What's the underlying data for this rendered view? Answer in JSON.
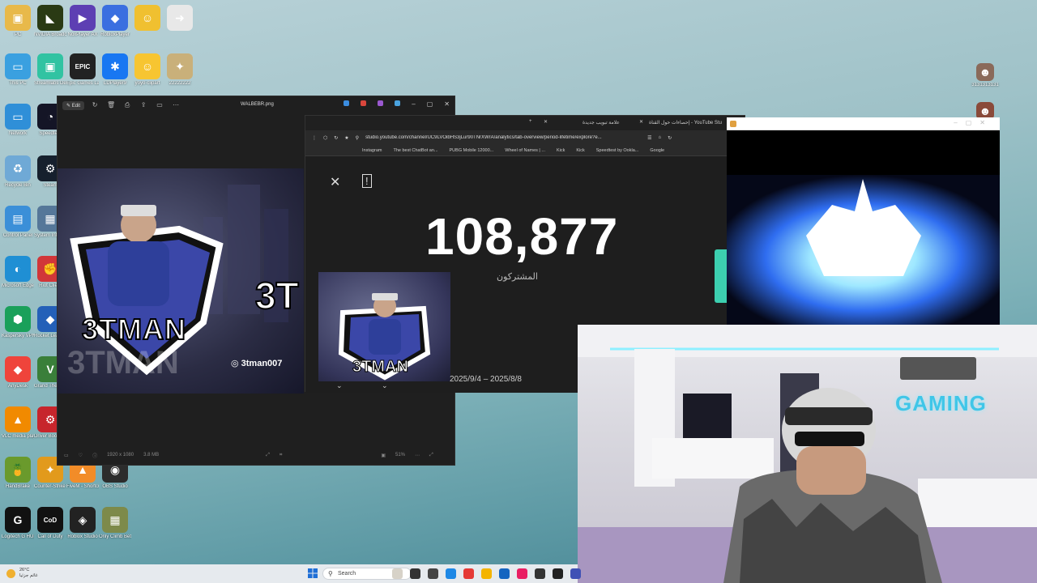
{
  "desktop": {
    "icons": [
      {
        "label": "PC",
        "color": "#e8b94a",
        "glyph": "▣"
      },
      {
        "label": "NVIDIA Broadcast",
        "color": "#2a3a14",
        "glyph": "◣"
      },
      {
        "label": "NoxPlayer AX",
        "color": "#5d3fb3",
        "glyph": "▶"
      },
      {
        "label": "RobloxPlayer",
        "color": "#3a6fe0",
        "glyph": "◆"
      },
      {
        "label": "",
        "color": "#f0c030",
        "glyph": "☺"
      },
      {
        "label": "",
        "color": "#e8e8e8",
        "glyph": "➜"
      },
      {
        "label": "This PC",
        "color": "#3aa0e0",
        "glyph": "▭"
      },
      {
        "label": "Streamlabs Desktop",
        "color": "#31c3a2",
        "glyph": "▣"
      },
      {
        "label": "Epic Games Launcher",
        "color": "#222222",
        "glyph": "EPIC"
      },
      {
        "label": "LDPlayer9",
        "color": "#1877f2",
        "glyph": "✱"
      },
      {
        "label": "yoyo-clipart",
        "color": "#f7c531",
        "glyph": "☺"
      },
      {
        "label": "22222222",
        "color": "#c9b07a",
        "glyph": "✦"
      },
      {
        "label": "Network",
        "color": "#2f8fd8",
        "glyph": "▭"
      },
      {
        "label": "Speedtest",
        "color": "#141526",
        "glyph": "◔"
      },
      {
        "label": "Recycle Bin",
        "color": "#6fa9d6",
        "glyph": "♻"
      },
      {
        "label": "Steam",
        "color": "#16202d",
        "glyph": "⚙"
      },
      {
        "label": "Control Panel",
        "color": "#3b8fd8",
        "glyph": "▤"
      },
      {
        "label": "System Information",
        "color": "#557799",
        "glyph": "▦"
      },
      {
        "label": "Microsoft Edge",
        "color": "#1f8fd4",
        "glyph": "◐"
      },
      {
        "label": "Riot Client",
        "color": "#d13639",
        "glyph": "✊"
      },
      {
        "label": "Kaspersky VPN",
        "color": "#1aa05a",
        "glyph": "⬢"
      },
      {
        "label": "Rocket League",
        "color": "#2460b8",
        "glyph": "◆"
      },
      {
        "label": "AnyDesk",
        "color": "#ef443b",
        "glyph": "◆"
      },
      {
        "label": "Grand Theft Auto V",
        "color": "#3a7f3a",
        "glyph": "V"
      },
      {
        "label": "VLC media player",
        "color": "#f18a00",
        "glyph": "▲"
      },
      {
        "label": "Driver Booster 12",
        "color": "#c7252c",
        "glyph": "⚙"
      },
      {
        "label": "HandBrake",
        "color": "#6a9a2c",
        "glyph": "🍍"
      },
      {
        "label": "Counter-Strike 2",
        "color": "#e29a1c",
        "glyph": "✦"
      },
      {
        "label": "FiveM - Shortcut",
        "color": "#f28c28",
        "glyph": "▲"
      },
      {
        "label": "OBS Studio",
        "color": "#2c2c2c",
        "glyph": "◉"
      },
      {
        "label": "Logitech G HUB",
        "color": "#111111",
        "glyph": "G"
      },
      {
        "label": "Call of Duty",
        "color": "#111111",
        "glyph": "CoD"
      },
      {
        "label": "Roblox Studio",
        "color": "#222222",
        "glyph": "◈"
      },
      {
        "label": "Only Climb Better To...",
        "color": "#7d8a4a",
        "glyph": "▦"
      }
    ],
    "right_icons": [
      {
        "label": "3131313131",
        "color": "#8a6a5a",
        "glyph": "☻"
      },
      {
        "label": "",
        "color": "#8a4a3a",
        "glyph": "☻"
      }
    ]
  },
  "photos_window": {
    "edit_label": "Edit",
    "filename": "WALBEBR.png",
    "dimensions": "1920 x 1080",
    "file_size": "3.8 MB",
    "zoom": "51%",
    "banner_name": "3TMAN",
    "banner_name_shadow": "3TMAN",
    "banner_name_right": "3T",
    "instagram_handle": "3tman007"
  },
  "browser": {
    "tabs": [
      {
        "label": "علامة تبويب جديدة"
      },
      {
        "label": "إحصاءات حول القناة - YouTube Studio"
      }
    ],
    "url": "studio.youtube.com/channel/UC9LVOibHS3jLur90TNrXWrA/analytics/tab-overview/period-lifetime/explore?e...",
    "bookmarks": [
      "Instagram",
      "The best ChatBot an...",
      "PUBG Mobile 12000...",
      "Wheel of Names | ...",
      "Kick",
      "Kick",
      "Speedtest by Ookla...",
      "Google"
    ],
    "subscriber_count": "108,877",
    "subscriber_label": "المشتركون",
    "date_range": "2025/9/4 – 2025/8/8",
    "thumb_name": "3TMAN"
  },
  "webcam": {
    "sign_text": "GAMING"
  },
  "taskbar": {
    "temperature": "26°C",
    "weather_text": "غائم جزئيا",
    "search_placeholder": "Search"
  }
}
